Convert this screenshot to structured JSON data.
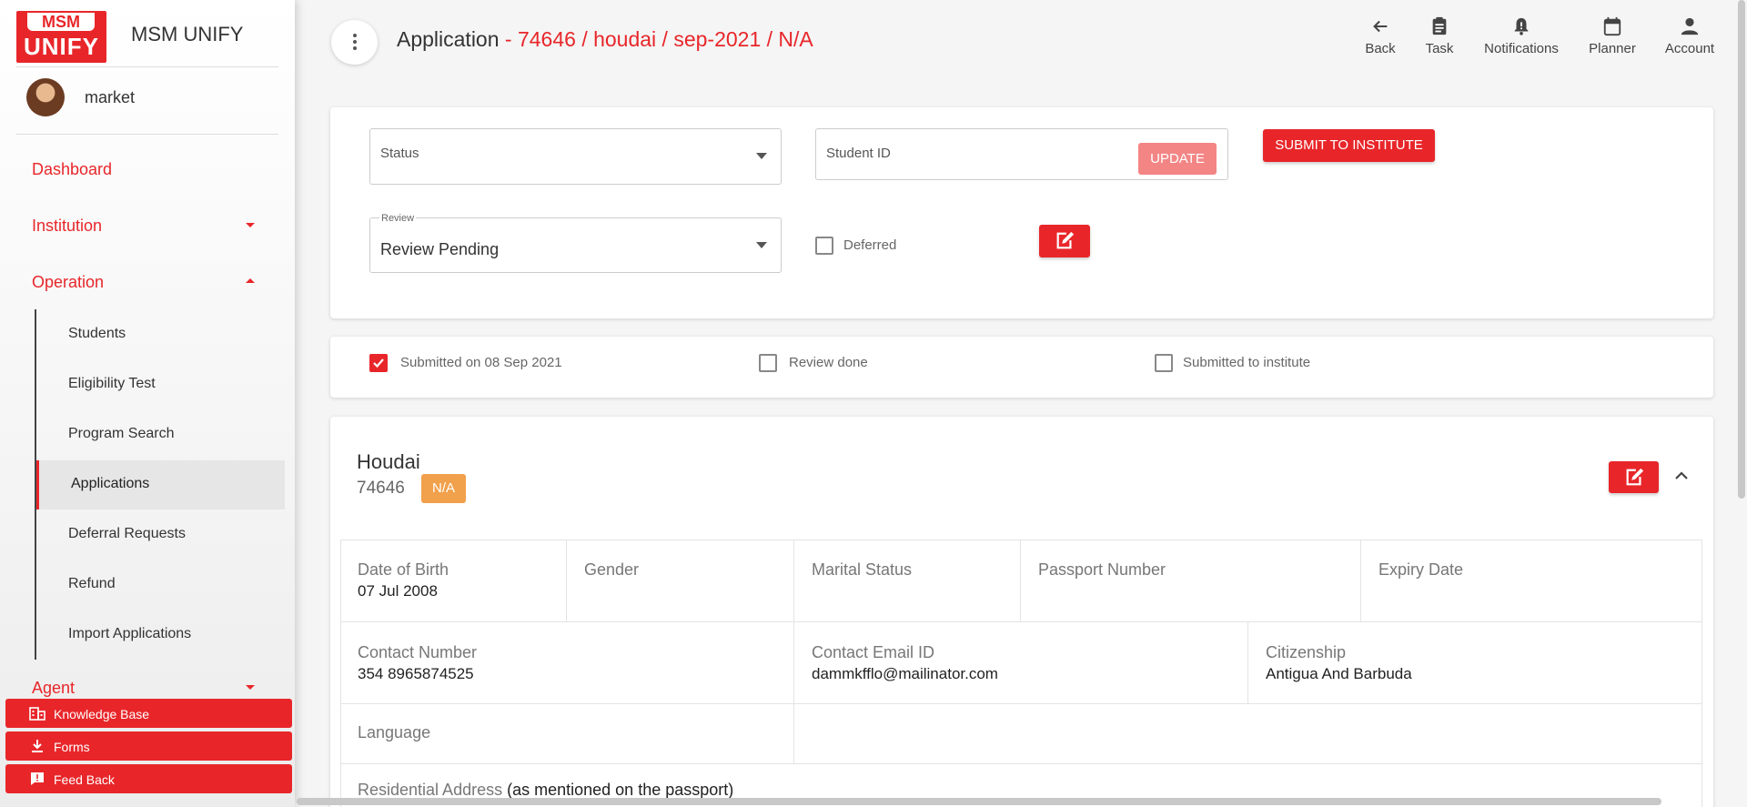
{
  "app": {
    "name": "MSM UNIFY",
    "logo_top": "MSM",
    "logo_bottom": "UNIFY"
  },
  "user": {
    "name": "market"
  },
  "sidebar": {
    "main_items": [
      {
        "label": "Dashboard"
      },
      {
        "label": "Institution",
        "caret": "down"
      },
      {
        "label": "Operation",
        "caret": "up"
      },
      {
        "label": "Agent",
        "caret": "down"
      }
    ],
    "sub_items": [
      {
        "label": "Students"
      },
      {
        "label": "Eligibility Test"
      },
      {
        "label": "Program Search"
      },
      {
        "label": "Applications",
        "active": true
      },
      {
        "label": "Deferral Requests"
      },
      {
        "label": "Refund"
      },
      {
        "label": "Import Applications"
      }
    ],
    "bottom_buttons": [
      {
        "label": "Knowledge Base",
        "icon": "building-icon"
      },
      {
        "label": "Forms",
        "icon": "download-icon"
      },
      {
        "label": "Feed Back",
        "icon": "feedback-icon"
      }
    ]
  },
  "header": {
    "title": "Application",
    "crumbs": " - 74646 / houdai / sep-2021 / N/A",
    "actions": [
      {
        "label": "Back",
        "icon": "arrow-left-icon"
      },
      {
        "label": "Task",
        "icon": "clipboard-icon"
      },
      {
        "label": "Notifications",
        "icon": "bell-icon"
      },
      {
        "label": "Planner",
        "icon": "calendar-icon"
      },
      {
        "label": "Account",
        "icon": "person-icon"
      }
    ]
  },
  "form": {
    "status_label": "Status",
    "student_id_label": "Student ID",
    "update_label": "UPDATE",
    "submit_label": "SUBMIT TO INSTITUTE",
    "review_label": "Review",
    "review_value": "Review Pending",
    "deferred_label": "Deferred"
  },
  "progress": [
    {
      "label": "Submitted on 08 Sep 2021",
      "checked": true
    },
    {
      "label": "Review done",
      "checked": false
    },
    {
      "label": "Submitted to institute",
      "checked": false
    }
  ],
  "student": {
    "name": "Houdai",
    "id": "74646",
    "badge": "N/A",
    "details": {
      "dob_label": "Date of Birth",
      "dob": "07 Jul 2008",
      "gender_label": "Gender",
      "gender": "",
      "marital_label": "Marital Status",
      "marital": "",
      "passport_label": "Passport Number",
      "passport": "",
      "expiry_label": "Expiry Date",
      "expiry": "",
      "contact_label": "Contact Number",
      "contact": "354 8965874525",
      "email_label": "Contact Email ID",
      "email": "dammkfflo@mailinator.com",
      "citizenship_label": "Citizenship",
      "citizenship": "Antigua And Barbuda",
      "language_label": "Language",
      "language": "",
      "address_label": "Residential Address",
      "address_note": "(as mentioned on the passport)"
    }
  },
  "colors": {
    "accent": "#e8262a",
    "badge": "#f1a04b",
    "update_disabled": "#f38585"
  }
}
